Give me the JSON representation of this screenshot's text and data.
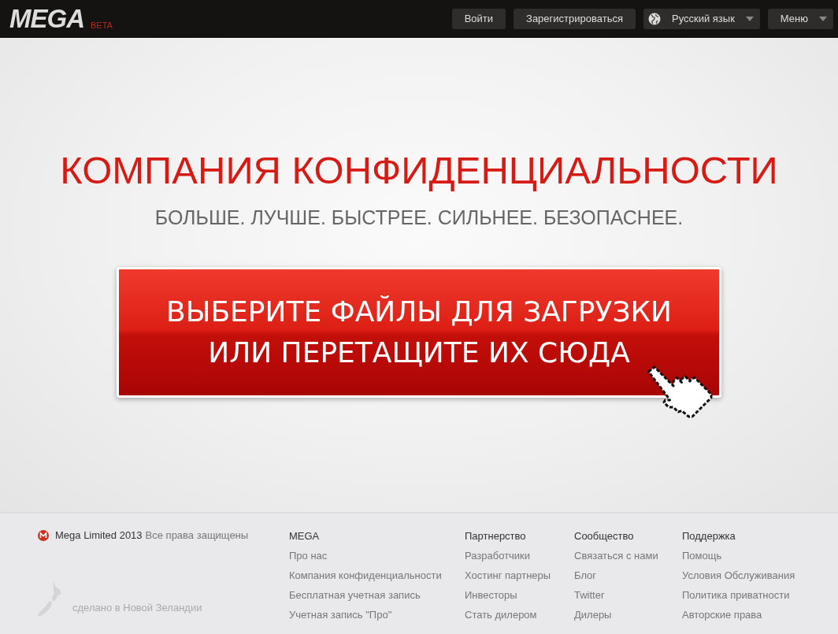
{
  "header": {
    "logo": "MEGA",
    "badge": "BETA",
    "buttons": [
      {
        "label": "Войти",
        "kind": "plain"
      },
      {
        "label": "Зарегистрироваться",
        "kind": "plain"
      },
      {
        "label": "Русский язык",
        "kind": "language"
      },
      {
        "label": "Меню",
        "kind": "menu"
      }
    ]
  },
  "hero": {
    "title": "КОМПАНИЯ КОНФИДЕНЦИАЛЬНОСТИ",
    "subtitle": "БОЛЬШЕ. ЛУЧШЕ. БЫСТРЕЕ. СИЛЬНЕЕ. БЕЗОПАСНЕЕ.",
    "upload_lines": [
      "ВЫБЕРИТЕ ФАЙЛЫ ДЛЯ ЗАГРУЗКИ",
      "ИЛИ ПЕРЕТАЩИТЕ ИХ СЮДА"
    ]
  },
  "footer": {
    "company": "Mega Limited 2013",
    "rights": "Все права защищены",
    "made_in": "сделано в Новой Зеландии",
    "columns": [
      {
        "heading": "MEGA",
        "links": [
          "Про нас",
          "Компания конфиденциальности",
          "Бесплатная учетная запись",
          "Учетная запись \"Про\""
        ]
      },
      {
        "heading": "Партнерство",
        "links": [
          "Разработчики",
          "Хостинг партнеры",
          "Инвесторы",
          "Стать дилером"
        ]
      },
      {
        "heading": "Сообщество",
        "links": [
          "Связаться с нами",
          "Блог",
          "Twitter",
          "Дилеры"
        ]
      },
      {
        "heading": "Поддержка",
        "links": [
          "Помощь",
          "Условия Обслуживания",
          "Политика приватности",
          "Авторские права"
        ]
      }
    ]
  }
}
